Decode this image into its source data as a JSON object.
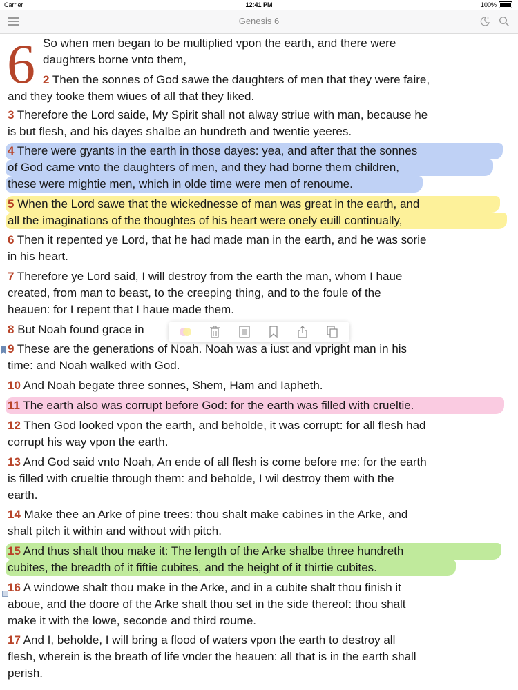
{
  "status": {
    "carrier": "Carrier",
    "time": "12:41 PM",
    "battery": "100%"
  },
  "header": {
    "title": "Genesis 6"
  },
  "chapter": {
    "number": "6"
  },
  "lines": [
    {
      "vn": "",
      "text": "So when men began to be multiplied vpon the earth, and there were"
    },
    {
      "vn": "",
      "text": "daughters borne vnto them,"
    },
    {
      "vn": "2",
      "text": " Then the sonnes of God sawe the daughters of men that they were faire,"
    },
    {
      "vn": "",
      "text": "and they tooke them wiues of all that they liked."
    },
    {
      "vn": "3",
      "text": " Therefore the Lord saide, My Spirit shall not alway striue with man, because he"
    },
    {
      "vn": "",
      "text": "is but flesh, and his dayes shalbe an hundreth and twentie yeeres."
    },
    {
      "vn": "4",
      "text": " There were gyants in the earth in those dayes: yea, and after that the sonnes"
    },
    {
      "vn": "",
      "text": "of God came vnto the daughters of men, and they had borne them children,"
    },
    {
      "vn": "",
      "text": "these were mightie men, which in olde time were men of renoume."
    },
    {
      "vn": "5",
      "text": " When the Lord sawe that the wickednesse of man was great in the earth, and"
    },
    {
      "vn": "",
      "text": "all the imaginations of the thoughtes of his heart were onely euill continually,"
    },
    {
      "vn": "6",
      "text": " Then it repented ye Lord, that he had made man in the earth, and he was sorie"
    },
    {
      "vn": "",
      "text": "in his heart."
    },
    {
      "vn": "7",
      "text": " Therefore ye Lord said, I will destroy from the earth the man, whom I haue"
    },
    {
      "vn": "",
      "text": "created, from man to beast, to the creeping thing, and to the foule of the"
    },
    {
      "vn": "",
      "text": "heauen: for I repent that I haue made them."
    },
    {
      "vn": "8",
      "text": " But Noah found grace in"
    },
    {
      "vn": "9",
      "text": " These are the generations of Noah. Noah was a iust and vpright man in his"
    },
    {
      "vn": "",
      "text": "time: and Noah walked with God."
    },
    {
      "vn": "10",
      "text": " And Noah begate three sonnes, Shem, Ham and Iapheth."
    },
    {
      "vn": "11",
      "text": " The earth also was corrupt before God: for the earth was filled with crueltie."
    },
    {
      "vn": "12",
      "text": " Then God looked vpon the earth, and beholde, it was corrupt: for all flesh had"
    },
    {
      "vn": "",
      "text": "corrupt his way vpon the earth."
    },
    {
      "vn": "13",
      "text": " And God said vnto Noah, An ende of all flesh is come before me: for the earth"
    },
    {
      "vn": "",
      "text": "is filled with crueltie through them: and beholde, I wil destroy them with the"
    },
    {
      "vn": "",
      "text": "earth."
    },
    {
      "vn": "14",
      "text": " Make thee an Arke of pine trees: thou shalt make cabines in the Arke, and"
    },
    {
      "vn": "",
      "text": "shalt pitch it within and without with pitch."
    },
    {
      "vn": "15",
      "text": " And thus shalt thou make it: The length of the Arke shalbe three hundreth"
    },
    {
      "vn": "",
      "text": "cubites, the breadth of it fiftie cubites, and the height of it thirtie cubites."
    },
    {
      "vn": "16",
      "text": " A windowe shalt thou make in the Arke, and in a cubite shalt thou finish it"
    },
    {
      "vn": "",
      "text": "aboue, and the doore of the Arke shalt thou set in the side thereof: thou shalt"
    },
    {
      "vn": "",
      "text": "make it with the lowe, seconde and third roume."
    },
    {
      "vn": "17",
      "text": " And I, beholde, I will bring a flood of waters vpon the earth to destroy all"
    },
    {
      "vn": "",
      "text": "flesh, wherein is the breath of life vnder the heauen: all that is in the earth shall"
    },
    {
      "vn": "",
      "text": "perish."
    }
  ],
  "highlights": [
    {
      "color": "blue",
      "hex": "#8aacec",
      "verse": "4"
    },
    {
      "color": "yellow",
      "hex": "#fcec78",
      "verse": "5"
    },
    {
      "color": "pink",
      "hex": "#f5a0c8",
      "verse": "11"
    },
    {
      "color": "green",
      "hex": "#96dc5a",
      "verse": "15"
    }
  ],
  "popup_icons": [
    "highlight-color-icon",
    "trash-icon",
    "note-icon",
    "bookmark-icon",
    "share-icon",
    "copy-icon"
  ],
  "colors": {
    "accent": "#b84429",
    "navbar_bg": "#f7f7f8"
  }
}
